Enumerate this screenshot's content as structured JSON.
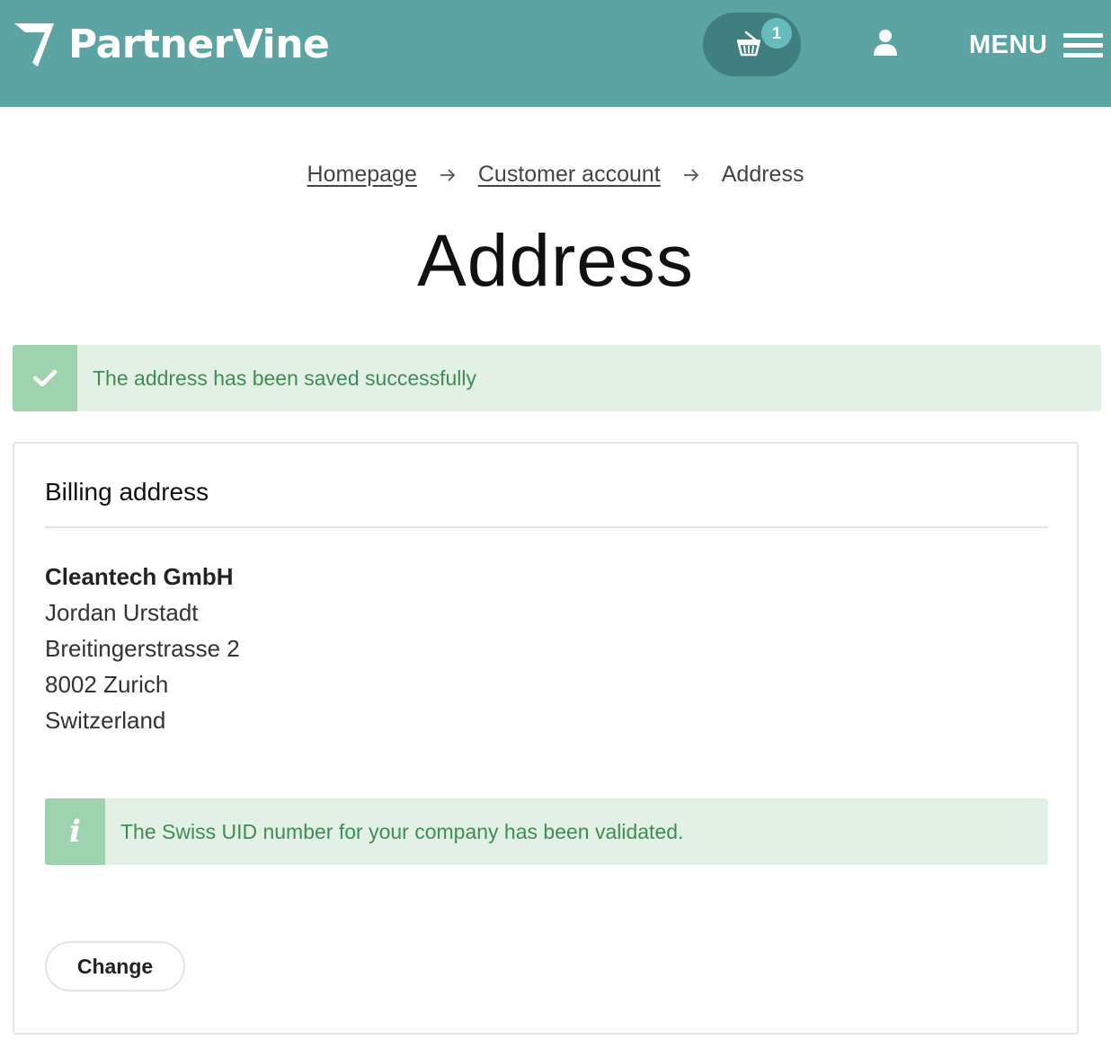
{
  "header": {
    "brand": "PartnerVine",
    "cart_count": "1",
    "menu_label": "MENU",
    "icons": {
      "logo": "partnervine-logo",
      "cart": "basket-icon",
      "user": "user-icon",
      "menu": "hamburger-icon"
    },
    "colors": {
      "bar": "#5ca3a3",
      "cart_pill": "#3f7f7f",
      "badge": "#66bcbc"
    }
  },
  "breadcrumb": {
    "items": [
      "Homepage",
      "Customer account",
      "Address"
    ]
  },
  "page": {
    "title": "Address"
  },
  "success_alert": {
    "text": "The address has been saved successfully",
    "icon": "check-icon",
    "colors": {
      "background": "#e2f0e6",
      "icon_box": "#9fd2ae",
      "text": "#3e8e54"
    }
  },
  "billing": {
    "title": "Billing address",
    "company": "Cleantech GmbH",
    "name": "Jordan Urstadt",
    "street": "Breitingerstrasse 2",
    "city": "8002 Zurich",
    "country": "Switzerland",
    "info_text": "The Swiss UID number for your company has been validated.",
    "info_icon": "info-icon",
    "change_label": "Change"
  }
}
